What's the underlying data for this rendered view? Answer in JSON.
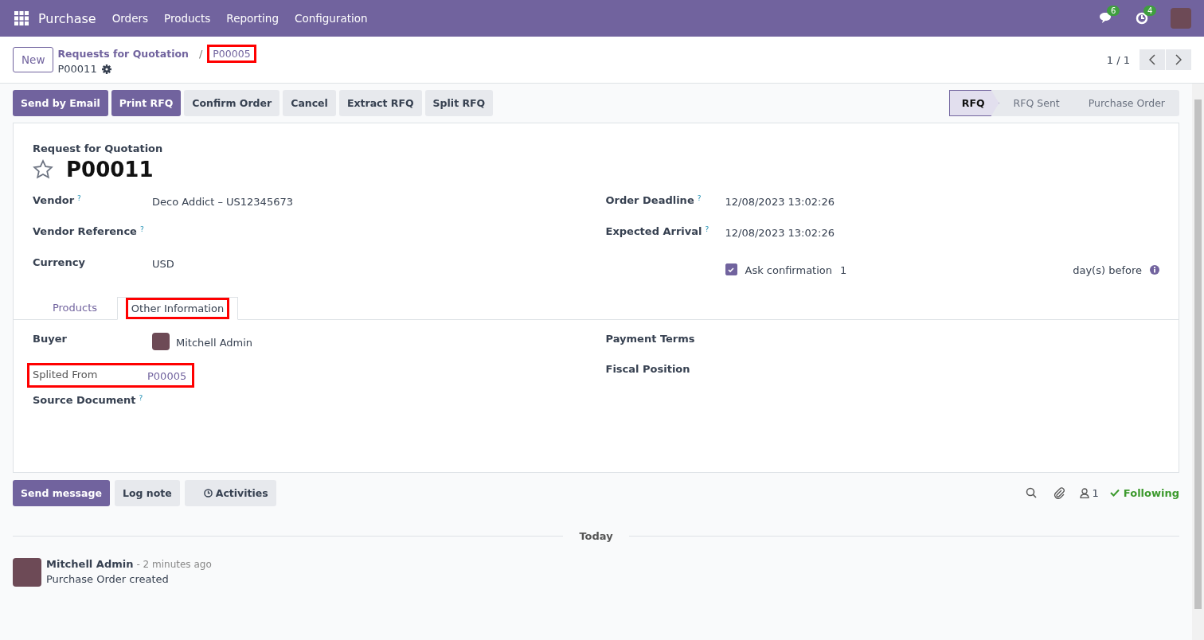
{
  "navbar": {
    "app": "Purchase",
    "menus": [
      "Orders",
      "Products",
      "Reporting",
      "Configuration"
    ],
    "messages_count": "6",
    "activities_count": "4"
  },
  "control_panel": {
    "new_button": "New",
    "breadcrumbs": [
      {
        "label": "Requests for Quotation",
        "highlighted": false
      },
      {
        "label": "P00005",
        "highlighted": true
      }
    ],
    "separator": "/",
    "current": "P00011",
    "pager": "1 / 1"
  },
  "actions": [
    {
      "label": "Send by Email",
      "kind": "primary"
    },
    {
      "label": "Print RFQ",
      "kind": "primary"
    },
    {
      "label": "Confirm Order",
      "kind": "secondary"
    },
    {
      "label": "Cancel",
      "kind": "secondary"
    },
    {
      "label": "Extract RFQ",
      "kind": "secondary"
    },
    {
      "label": "Split RFQ",
      "kind": "secondary"
    }
  ],
  "statusbar": [
    {
      "label": "RFQ",
      "selected": true
    },
    {
      "label": "RFQ Sent",
      "selected": false
    },
    {
      "label": "Purchase Order",
      "selected": false
    }
  ],
  "form": {
    "subtitle": "Request for Quotation",
    "title": "P00011",
    "favorite": false,
    "left_fields": [
      {
        "label": "Vendor",
        "help": "?",
        "value": "Deco Addict – US12345673"
      },
      {
        "label": "Vendor Reference",
        "help": "?"
      },
      {
        "label": "Currency",
        "value": "USD"
      }
    ],
    "right_fields": [
      {
        "label": "Order Deadline",
        "help": "?",
        "value": "12/08/2023 13:02:26"
      },
      {
        "label": "Expected Arrival",
        "help": "?",
        "value": "12/08/2023 13:02:26"
      }
    ],
    "ask_confirmation": {
      "checked": true,
      "label": "Ask confirmation",
      "days": "1",
      "suffix": "day(s) before"
    },
    "tabs": [
      {
        "label": "Products",
        "selected": false,
        "highlighted": false
      },
      {
        "label": "Other Information",
        "selected": true,
        "highlighted": true
      }
    ],
    "other_left": [
      {
        "label": "Buyer",
        "value": "Mitchell Admin",
        "kind": "user",
        "highlighted": false
      },
      {
        "label": "Splited From",
        "value": "P00005",
        "kind": "link",
        "highlighted": true
      },
      {
        "label": "Source Document",
        "help": "?",
        "kind": "text",
        "highlighted": false
      }
    ],
    "other_right": [
      {
        "label": "Payment Terms"
      },
      {
        "label": "Fiscal Position"
      }
    ]
  },
  "chatter": {
    "buttons": [
      {
        "label": "Send message",
        "kind": "primary"
      },
      {
        "label": "Log note",
        "kind": "secondary"
      },
      {
        "label": "Activities",
        "kind": "activities"
      }
    ],
    "followers": "1",
    "following": "Following",
    "date_separator": "Today",
    "messages": [
      {
        "author": "Mitchell Admin",
        "time": "- 2 minutes ago",
        "body": "Purchase Order created"
      }
    ]
  }
}
